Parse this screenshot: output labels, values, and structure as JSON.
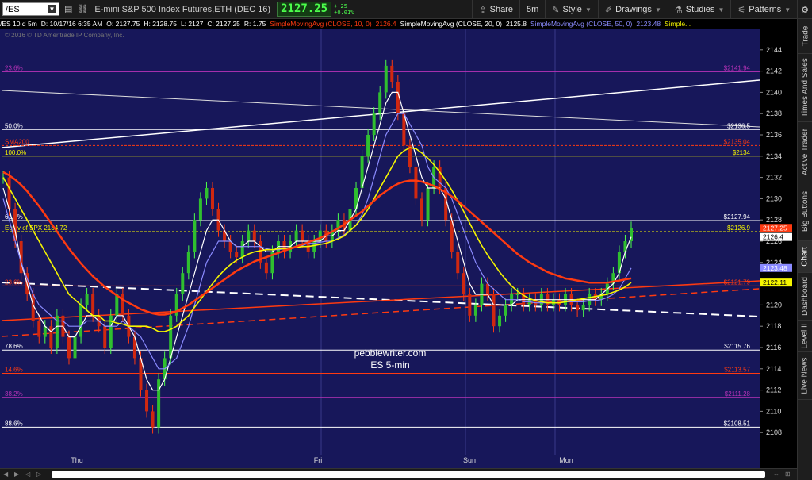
{
  "toolbar": {
    "symbol": "/ES",
    "instrument": "E-mini S&P 500 Index Futures,ETH (DEC 16)",
    "last": "2127.25",
    "change_top": "+.25",
    "change_bottom": "+0.01%",
    "share": "Share",
    "timeframe": "5m",
    "style": "Style",
    "drawings": "Drawings",
    "studies": "Studies",
    "patterns": "Patterns"
  },
  "infobar": {
    "symbol": "/ES 10 d 5m",
    "date": "D: 10/17/16 6:35 AM",
    "open": "O: 2127.75",
    "high": "H: 2128.75",
    "low": "L: 2127",
    "close": "C: 2127.25",
    "range": "R: 1.75",
    "sma10": "SimpleMovingAvg (CLOSE, 10, 0)",
    "sma10_val": "2126.4",
    "sma20": "SimpleMovingAvg (CLOSE, 20, 0)",
    "sma20_val": "2125.8",
    "sma50": "SimpleMovingAvg (CLOSE, 50, 0)",
    "sma50_val": "2123.48",
    "more": "Simple..."
  },
  "copyright": "© 2016 © TD Ameritrade IP Company, Inc.",
  "watermark": {
    "line1": "pebblewriter.com",
    "line2": "ES 5-min"
  },
  "colors": {
    "bg": "#17175a",
    "fib": "#b833b8",
    "yellow": "#f5f500",
    "red": "#ff3a10",
    "blue": "#8b8bff",
    "white": "#ffffff"
  },
  "rail": {
    "tabs": [
      "Trade",
      "Times And Sales",
      "Active Trader",
      "Big Buttons",
      "Chart",
      "Dashboard",
      "Level II",
      "Live News"
    ],
    "active": "Chart"
  },
  "chart_data": {
    "type": "line",
    "title": "",
    "ylim": [
      2106,
      2146
    ],
    "yticks": [
      "2144",
      "2142",
      "2140",
      "2138",
      "2136",
      "2134",
      "2132",
      "2130",
      "2128",
      "2126",
      "2124",
      "2122",
      "2120",
      "2118",
      "2116",
      "2114",
      "2112",
      "2110",
      "2108"
    ],
    "xlabels": [
      "Thu",
      "Fri",
      "Sun",
      "Mon"
    ],
    "levels": [
      {
        "left": "23.6%",
        "right": "$2141.94",
        "y": 2141.94,
        "color": "#b833b8"
      },
      {
        "left": "50.0%",
        "right": "$2136.5",
        "y": 2136.5,
        "color": "#ffffff"
      },
      {
        "left": "SMA200",
        "right": "$2135.04",
        "y": 2135.0,
        "color": "#ff3a10",
        "dashed": true
      },
      {
        "left": "100.0%",
        "right": "$2134",
        "y": 2134.0,
        "color": "#f5f500"
      },
      {
        "left": "61.8%",
        "right": "$2127.94",
        "y": 2127.94,
        "color": "#ffffff"
      },
      {
        "left": "Equiv of SPX 2134.72",
        "right": "$2126.9",
        "y": 2126.9,
        "color": "#f5f500",
        "dashed": true
      },
      {
        "left": "23.6%",
        "right": "$2121.79",
        "y": 2121.79,
        "color": "#ff3a10"
      },
      {
        "left": "78.6%",
        "right": "$2115.76",
        "y": 2115.76,
        "color": "#ffffff"
      },
      {
        "left": "14.6%",
        "right": "$2113.57",
        "y": 2113.57,
        "color": "#ff3a10"
      },
      {
        "left": "38.2%",
        "right": "$2111.28",
        "y": 2111.28,
        "color": "#b833b8"
      },
      {
        "left": "88.6%",
        "right": "$2108.51",
        "y": 2108.51,
        "color": "#ffffff"
      }
    ],
    "price_flags": [
      {
        "label": "2127.25",
        "y": 2127.25,
        "bg": "#ff3a10",
        "fg": "#ffffff"
      },
      {
        "label": "2126.4",
        "y": 2126.4,
        "bg": "#ffffff",
        "fg": "#000000"
      },
      {
        "label": "2123.48",
        "y": 2123.48,
        "bg": "#8b8bff",
        "fg": "#ffffff"
      },
      {
        "label": "2122.11",
        "y": 2122.11,
        "bg": "#f5f500",
        "fg": "#000000"
      }
    ],
    "series": [
      {
        "key": "close",
        "y": [
          2132,
          2129,
          2126,
          2123,
          2121,
          2118.5,
          2117,
          2118,
          2116,
          2119,
          2117,
          2115,
          2117,
          2120,
          2121,
          2119,
          2118,
          2116,
          2119,
          2121,
          2119,
          2117,
          2115,
          2112,
          2110,
          2108.5,
          2113,
          2115,
          2119,
          2121,
          2123,
          2125,
          2128,
          2130,
          2131,
          2129,
          2127,
          2126,
          2125,
          2124.5,
          2126,
          2127,
          2126,
          2124,
          2123,
          2125,
          2126,
          2125,
          2126,
          2127,
          2126,
          2125,
          2126,
          2127,
          2126,
          2127,
          2128,
          2127,
          2129,
          2131,
          2134,
          2136,
          2138,
          2140,
          2142.5,
          2141,
          2138,
          2135,
          2133,
          2130,
          2128,
          2131,
          2133,
          2131,
          2128,
          2125,
          2123,
          2121,
          2119,
          2120,
          2122,
          2121,
          2118,
          2119,
          2120,
          2121,
          2121,
          2120,
          2120.5,
          2120,
          2121,
          2120,
          2120.5,
          2120,
          2121,
          2120,
          2119.5,
          2120,
          2121,
          2120.5,
          2121,
          2122,
          2123,
          2125,
          2126,
          2127.25
        ]
      },
      {
        "key": "sma10",
        "color": "#ffffff",
        "y": [
          2131,
          2129,
          2127,
          2124,
          2122,
          2120,
          2119,
          2118,
          2117.5,
          2118,
          2118,
          2117,
          2117,
          2118,
          2119,
          2119,
          2118.5,
          2118,
          2118,
          2119,
          2119,
          2118,
          2117,
          2115,
          2113,
          2112,
          2112,
          2113,
          2115,
          2117,
          2119,
          2121,
          2123,
          2125,
          2127,
          2128,
          2128,
          2127,
          2126,
          2125.5,
          2125.5,
          2126,
          2126,
          2125.5,
          2125,
          2125,
          2125.5,
          2125.5,
          2125.5,
          2126,
          2126,
          2126,
          2126,
          2126,
          2126.5,
          2126.5,
          2127,
          2127,
          2128,
          2129,
          2131,
          2133,
          2135,
          2137,
          2139,
          2140,
          2140,
          2138,
          2136,
          2134,
          2132,
          2131,
          2131,
          2131,
          2130,
          2128,
          2126,
          2124,
          2122,
          2121,
          2121,
          2121,
          2120,
          2120,
          2120,
          2120,
          2120.5,
          2120.5,
          2120.5,
          2120.5,
          2120.5,
          2120.5,
          2120.5,
          2120.5,
          2120.5,
          2120.5,
          2120.5,
          2120.5,
          2120.5,
          2120.5,
          2121,
          2121.5,
          2122,
          2123,
          2125,
          2126.4
        ]
      },
      {
        "key": "sma20",
        "color": "#8b8bff",
        "y": [
          2130,
          2128,
          2126,
          2124,
          2122.5,
          2121,
          2120,
          2119.5,
          2119,
          2118.5,
          2118.5,
          2118,
          2118,
          2118,
          2118.5,
          2118.5,
          2118.5,
          2118,
          2118,
          2118,
          2118.5,
          2118,
          2117.5,
          2117,
          2116,
          2115,
          2114,
          2114,
          2114.5,
          2115,
          2116.5,
          2118,
          2120,
          2122,
          2124,
          2125,
          2126,
          2126,
          2126,
          2125.5,
          2125.5,
          2125.5,
          2125.5,
          2125.5,
          2125.3,
          2125.2,
          2125.2,
          2125.3,
          2125.3,
          2125.4,
          2125.6,
          2125.8,
          2125.8,
          2125.9,
          2126,
          2126,
          2126.3,
          2126.6,
          2127,
          2127.5,
          2128.5,
          2130,
          2132,
          2134,
          2136,
          2137,
          2138,
          2138,
          2137,
          2136,
          2135,
          2133,
          2132,
          2131.5,
          2131,
          2130,
          2128.5,
          2127,
          2125.5,
          2124,
          2123,
          2122,
          2121.5,
          2121,
          2120.5,
          2120.5,
          2120.5,
          2120.3,
          2120.3,
          2120.2,
          2120.2,
          2120.2,
          2120.2,
          2120.2,
          2120.3,
          2120.3,
          2120.3,
          2120.3,
          2120.4,
          2120.4,
          2120.5,
          2120.7,
          2121,
          2121.5,
          2122.5,
          2123.48
        ]
      },
      {
        "key": "sma50",
        "color": "#f5f500",
        "y": [
          2132,
          2131,
          2130,
          2129,
          2128,
          2127,
          2126,
          2125,
          2124,
          2123,
          2122,
          2121,
          2120.5,
          2120,
          2119.5,
          2119,
          2119,
          2118.5,
          2118.5,
          2118.3,
          2118.2,
          2118,
          2118,
          2118,
          2118,
          2117.8,
          2117.5,
          2117.5,
          2117.7,
          2118,
          2118.5,
          2119,
          2119.8,
          2120.5,
          2121.3,
          2122,
          2122.7,
          2123.3,
          2123.8,
          2124.2,
          2124.5,
          2124.8,
          2125,
          2125.1,
          2125.2,
          2125.2,
          2125.3,
          2125.3,
          2125.4,
          2125.4,
          2125.5,
          2125.5,
          2125.6,
          2125.7,
          2125.8,
          2126,
          2126.2,
          2126.5,
          2127,
          2127.5,
          2128.2,
          2129,
          2130,
          2131,
          2132,
          2133,
          2134,
          2134.5,
          2134.8,
          2134.7,
          2134.3,
          2133.8,
          2133.2,
          2132.5,
          2131.7,
          2130.8,
          2129.8,
          2128.8,
          2127.7,
          2126.6,
          2125.6,
          2124.7,
          2123.9,
          2123.1,
          2122.4,
          2121.8,
          2121.3,
          2120.9,
          2120.6,
          2120.4,
          2120.3,
          2120.2,
          2120.2,
          2120.2,
          2120.3,
          2120.4,
          2120.5,
          2120.6,
          2120.7,
          2120.8,
          2120.9,
          2121,
          2121.2,
          2121.4,
          2121.7,
          2122.11
        ]
      },
      {
        "key": "sma200",
        "color": "#ff3a10",
        "y": [
          2132.5,
          2132.2,
          2131.8,
          2131.3,
          2130.7,
          2130,
          2129.3,
          2128.5,
          2127.7,
          2126.9,
          2126.1,
          2125.3,
          2124.6,
          2123.9,
          2123.3,
          2122.7,
          2122.2,
          2121.7,
          2121.3,
          2120.9,
          2120.5,
          2120.2,
          2119.9,
          2119.6,
          2119.4,
          2119.2,
          2119.1,
          2119.1,
          2119.2,
          2119.4,
          2119.7,
          2120,
          2120.4,
          2120.8,
          2121.2,
          2121.6,
          2122,
          2122.4,
          2122.8,
          2123.2,
          2123.5,
          2123.8,
          2124.1,
          2124.3,
          2124.5,
          2124.7,
          2124.9,
          2125.1,
          2125.3,
          2125.5,
          2125.7,
          2125.9,
          2126.1,
          2126.3,
          2126.6,
          2126.9,
          2127.2,
          2127.6,
          2128,
          2128.4,
          2128.8,
          2129.3,
          2129.8,
          2130.3,
          2130.7,
          2131.1,
          2131.4,
          2131.6,
          2131.7,
          2131.7,
          2131.6,
          2131.4,
          2131.2,
          2130.9,
          2130.6,
          2130.2,
          2129.8,
          2129.3,
          2128.8,
          2128.3,
          2127.8,
          2127.3,
          2126.8,
          2126.3,
          2125.8,
          2125.3,
          2124.8,
          2124.4,
          2124,
          2123.7,
          2123.4,
          2123.1,
          2122.9,
          2122.7,
          2122.5,
          2122.4,
          2122.3,
          2122.2,
          2122.1,
          2122.1,
          2122.1,
          2122.1,
          2122.2,
          2122.3,
          2122.4,
          2122.5
        ]
      }
    ]
  }
}
